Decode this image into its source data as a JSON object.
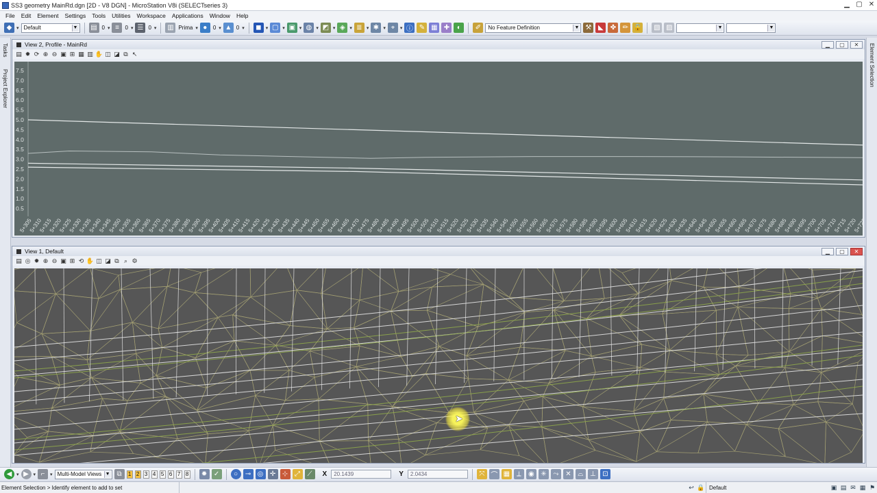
{
  "window": {
    "title": "SS3 geometry MainRd.dgn [2D - V8 DGN] - MicroStation V8i (SELECTseries 3)"
  },
  "menu": [
    "File",
    "Edit",
    "Element",
    "Settings",
    "Tools",
    "Utilities",
    "Workspace",
    "Applications",
    "Window",
    "Help"
  ],
  "toolbar": {
    "level_value": "Default",
    "color_value": "0",
    "weight_value": "0",
    "style_value": "0",
    "class_value": "Prima",
    "transparency_value": "0",
    "priority_value": "0",
    "feature_definition": "No Feature Definition"
  },
  "dock": {
    "left_tabs": [
      "Tasks",
      "Project Explorer"
    ],
    "right_tabs": [
      "Element Selection"
    ]
  },
  "view2": {
    "title": "View 2, Profile - MainRd",
    "y_ticks": [
      "7.5",
      "7.0",
      "6.5",
      "6.0",
      "5.5",
      "5.0",
      "4.5",
      "4.0",
      "3.5",
      "3.0",
      "2.5",
      "2.0",
      "1.5",
      "1.0",
      "0.5"
    ],
    "station_start": 305,
    "station_step": 5,
    "station_count": 85,
    "station_prefix": "5+"
  },
  "view1": {
    "title": "View 1, Default"
  },
  "bottom_toolbar": {
    "model_views_label": "Multi-Model Views",
    "view_numbers": [
      "1",
      "2",
      "3",
      "4",
      "5",
      "6",
      "7",
      "8"
    ],
    "x_label": "X",
    "x_value": "20.1439",
    "y_label": "Y",
    "y_value": "2.0434"
  },
  "status": {
    "prompt": "Element Selection > Identify element to add to set",
    "active_level": "Default"
  },
  "colors": {
    "profile_bg": "#5f6b6a",
    "plan_bg": "#565656",
    "mesh_white": "#e6e6e6",
    "mesh_green": "#8fa84a"
  }
}
